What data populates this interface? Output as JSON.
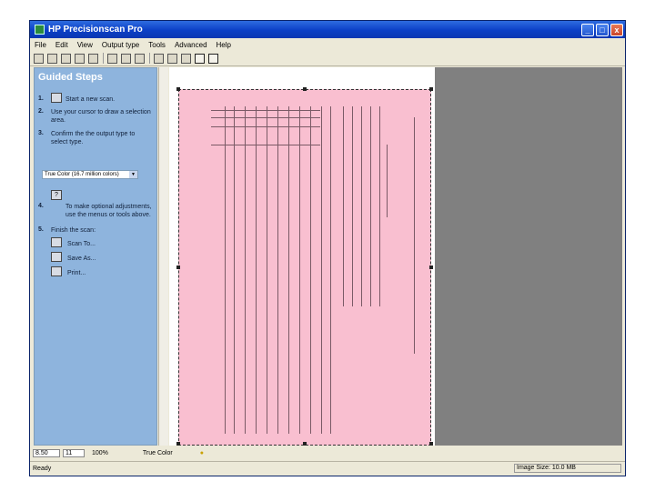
{
  "window": {
    "title": "HP Precisionscan Pro"
  },
  "title_buttons": {
    "minimize": "_",
    "maximize": "□",
    "close": "x"
  },
  "menu": [
    "File",
    "Edit",
    "View",
    "Output type",
    "Tools",
    "Advanced",
    "Help"
  ],
  "toolbar_icons": [
    "scan-icon",
    "save-icon",
    "copy-icon",
    "print-icon",
    "email-icon",
    "crop-icon",
    "zoom-icon",
    "zoom-out-icon",
    "lighten-icon",
    "darken-icon",
    "rotate-icon",
    "select-icon",
    "help-icon"
  ],
  "guided": {
    "header": "Guided Steps",
    "step1_num": "1.",
    "step1": "Start a new scan.",
    "step2_num": "2.",
    "step2": "Use your cursor to draw a selection area.",
    "step3_num": "3.",
    "step3": "Confirm the the output type to select type.",
    "output_type": "True Color (16.7 million colors)",
    "step4_num": "4.",
    "step4": "To make optional adjustments, use the menus or tools above.",
    "step5_num": "5.",
    "step5": "Finish the scan:",
    "scan_to": "Scan To...",
    "save_as": "Save As...",
    "print": "Print..."
  },
  "status_fields": {
    "width": "8.50",
    "height": "11",
    "zoom": "100%",
    "output": "True Color"
  },
  "statusbar": {
    "left": "Ready",
    "right": "Image Size: 10.0 MB"
  }
}
